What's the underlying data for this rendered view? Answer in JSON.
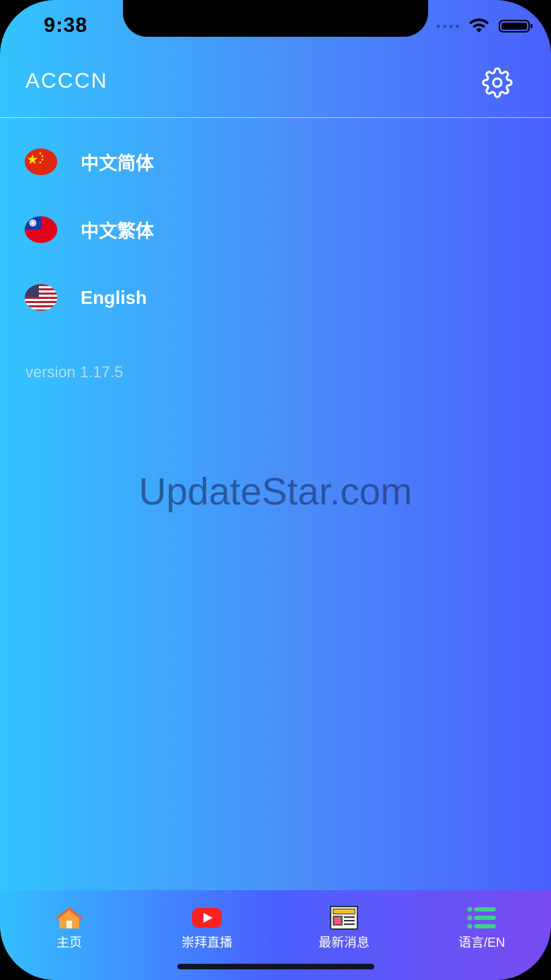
{
  "status_bar": {
    "time": "9:38"
  },
  "header": {
    "title": "ACCCN",
    "settings_icon": "gear-icon"
  },
  "languages": [
    {
      "label": "中文简体",
      "flag": "china-flag-icon"
    },
    {
      "label": "中文繁体",
      "flag": "taiwan-flag-icon"
    },
    {
      "label": "English",
      "flag": "us-flag-icon"
    }
  ],
  "version": "version 1.17.5",
  "watermark": "UpdateStar.com",
  "tabs": [
    {
      "label": "主页",
      "icon": "home-icon"
    },
    {
      "label": "崇拜直播",
      "icon": "play-icon"
    },
    {
      "label": "最新消息",
      "icon": "newspaper-icon"
    },
    {
      "label": "语言/EN",
      "icon": "list-icon"
    }
  ],
  "colors": {
    "gradient_start": "#33c4ff",
    "gradient_end": "#4a60ff",
    "tab_end": "#7a4af2"
  }
}
